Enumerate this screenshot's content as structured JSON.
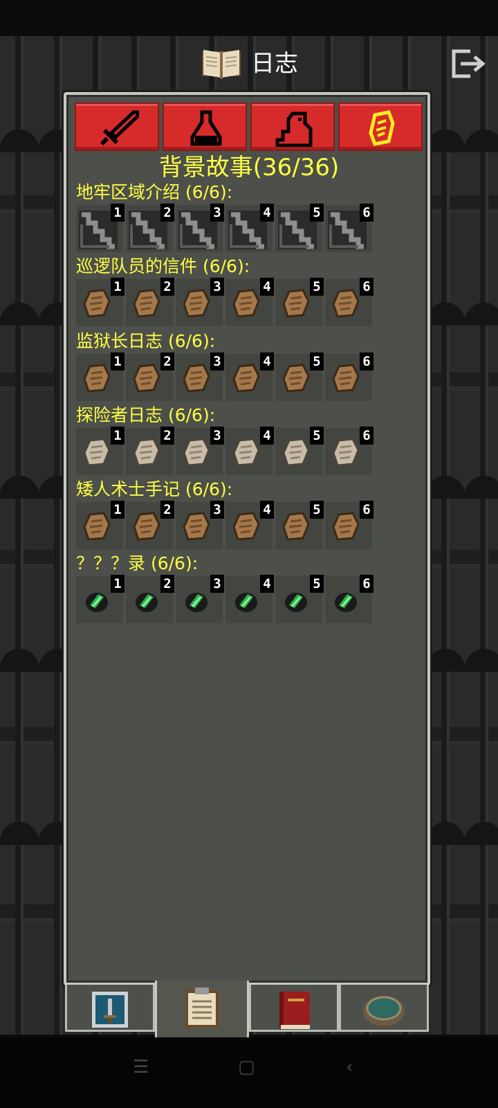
{
  "header": {
    "title": "日志"
  },
  "category_tabs": [
    "weapon-icon",
    "potion-icon",
    "creature-icon",
    "scroll-icon"
  ],
  "section": {
    "title": "背景故事",
    "count": "(36/36)"
  },
  "groups": [
    {
      "name": "地牢区域介绍",
      "progress": "(6/6):",
      "item": "stairs-icon",
      "numbers": [
        "1",
        "2",
        "3",
        "4",
        "5",
        "6"
      ]
    },
    {
      "name": "巡逻队员的信件",
      "progress": "(6/6):",
      "item": "letter-icon",
      "numbers": [
        "1",
        "2",
        "3",
        "4",
        "5",
        "6"
      ]
    },
    {
      "name": "监狱长日志",
      "progress": "(6/6):",
      "item": "letter-icon",
      "numbers": [
        "1",
        "2",
        "3",
        "4",
        "5",
        "6"
      ]
    },
    {
      "name": "探险者日志",
      "progress": "(6/6):",
      "item": "paper-icon",
      "numbers": [
        "1",
        "2",
        "3",
        "4",
        "5",
        "6"
      ]
    },
    {
      "name": "矮人术士手记",
      "progress": "(6/6):",
      "item": "letter-icon",
      "numbers": [
        "1",
        "2",
        "3",
        "4",
        "5",
        "6"
      ]
    },
    {
      "name": "？？？录",
      "progress": "(6/6):",
      "item": "green-crystal-icon",
      "numbers": [
        "1",
        "2",
        "3",
        "4",
        "5",
        "6"
      ]
    }
  ],
  "bottom_tabs": [
    "hero-tab",
    "journal-tab",
    "catalog-tab",
    "well-tab"
  ],
  "colors": {
    "accent": "#ffff44",
    "tab_red": "#d72a2a",
    "panel": "#4d4f4a"
  }
}
